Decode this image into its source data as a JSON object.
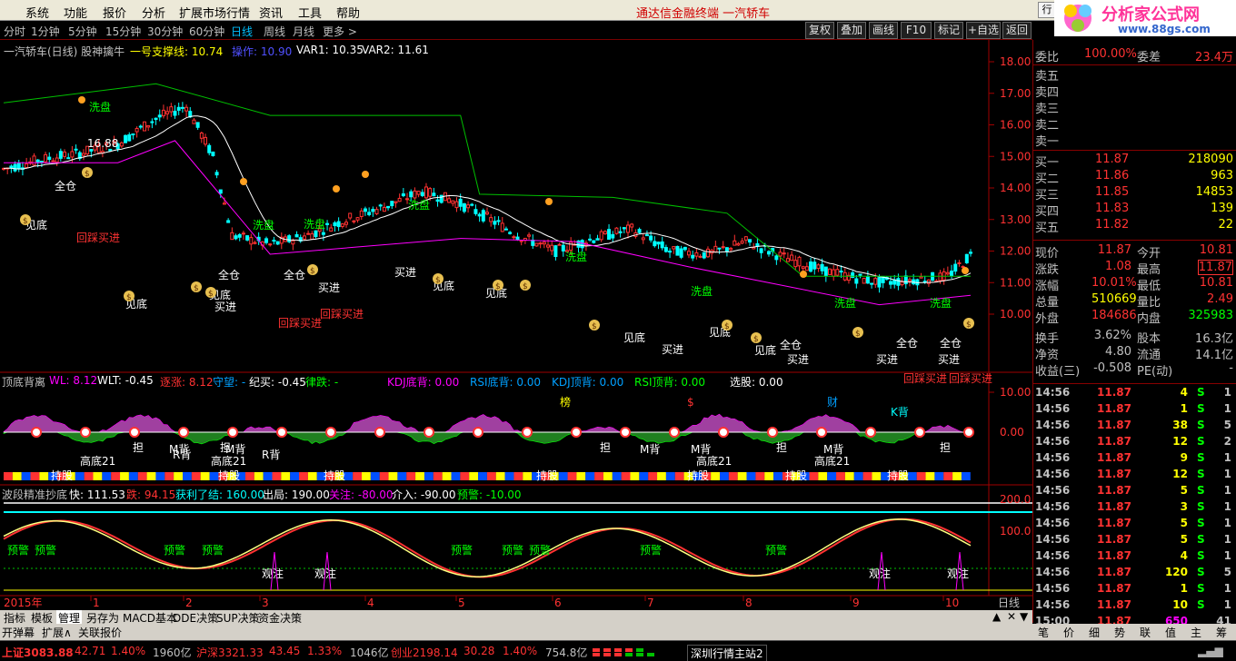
{
  "menu": [
    "系统",
    "功能",
    "报价",
    "分析",
    "扩展市场行情",
    "资讯",
    "工具",
    "帮助"
  ],
  "center_title": "通达信金融终端   一汽轿车",
  "periods": [
    "分时",
    "1分钟",
    "5分钟",
    "15分钟",
    "30分钟",
    "60分钟",
    "日线",
    "周线",
    "月线",
    "更多 >"
  ],
  "right_buttons": [
    "复权",
    "叠加",
    "画线",
    "F10",
    "标记",
    "+自选",
    "返回"
  ],
  "header": {
    "title": "一汽轿车(日线) 股神擒牛",
    "support": "一号支撑线: 10.74",
    "op": "操作: 10.90",
    "var1": "VAR1: 10.35",
    "var2": "VAR2: 11.61"
  },
  "price_axis": [
    "18.00",
    "17.00",
    "16.00",
    "15.00",
    "14.00",
    "13.00",
    "12.00",
    "11.00",
    "10.00"
  ],
  "ind1": {
    "title": "顶底背离",
    "wl": "WL: 8.12",
    "wlt": "WLT: -0.45",
    "zhang": "逐涨: 8.12",
    "sw": "守望: -",
    "jm": "纪买: -0.45",
    "lj": "律跌: -",
    "kdjdi": "KDJ底背: 0.00",
    "rsidi": "RSI底背: 0.00",
    "kdjding": "KDJ顶背: 0.00",
    "rsiding": "RSI顶背: 0.00",
    "xg": "选股: 0.00",
    "axis": [
      "10.00",
      "0.00"
    ]
  },
  "ind2": {
    "title": "波段精准抄底",
    "kuai": "快: 111.53",
    "die": "跌: 94.15",
    "hl": "获利了结: 160.00",
    "cj": "出局: 190.00",
    "gz": "关注: -80.00",
    "jr": "介入: -90.00",
    "yj": "预警: -10.00",
    "axis": [
      "200.0",
      "100.0"
    ]
  },
  "chart_labels": {
    "xipan": "洗盘",
    "quancang": "全仓",
    "jiandi": "见底",
    "mairu": "买进",
    "huicai": "回踩买进",
    "high": "16.88",
    "bang": "榜",
    "cai": "财",
    "gaodi": "高底21",
    "rbei": "R背",
    "mbei": "M背",
    "dan": "担",
    "chigu": "持股",
    "kbei": "K背",
    "guanzhu": "观注",
    "yujing": "预警",
    "dollar": "$"
  },
  "xaxis": {
    "year": "2015年",
    "months": [
      "1",
      "2",
      "3",
      "4",
      "5",
      "6",
      "7",
      "8",
      "9",
      "10"
    ],
    "period": "日线"
  },
  "quote": {
    "webi": "委比",
    "webi_v": "100.00%",
    "wecha": "委差",
    "wecha_v": "23.4万",
    "sells": [
      {
        "l": "卖五"
      },
      {
        "l": "卖四"
      },
      {
        "l": "卖三"
      },
      {
        "l": "卖二"
      },
      {
        "l": "卖一"
      }
    ],
    "buys": [
      {
        "l": "买一",
        "p": "11.87",
        "v": "218090"
      },
      {
        "l": "买二",
        "p": "11.86",
        "v": "963"
      },
      {
        "l": "买三",
        "p": "11.85",
        "v": "14853"
      },
      {
        "l": "买四",
        "p": "11.83",
        "v": "139"
      },
      {
        "l": "买五",
        "p": "11.82",
        "v": "22"
      }
    ],
    "rows": [
      [
        "现价",
        "11.87",
        "今开",
        "10.81"
      ],
      [
        "涨跌",
        "1.08",
        "最高",
        "11.87"
      ],
      [
        "涨幅",
        "10.01%",
        "最低",
        "10.81"
      ],
      [
        "总量",
        "510669",
        "量比",
        "2.49"
      ],
      [
        "外盘",
        "184686",
        "内盘",
        "325983"
      ],
      [
        "换手",
        "3.62%",
        "股本",
        "16.3亿"
      ],
      [
        "净资",
        "4.80",
        "流通",
        "14.1亿"
      ],
      [
        "收益(三)",
        "-0.508",
        "PE(动)",
        "-"
      ]
    ],
    "ticks": [
      [
        "14:56",
        "11.87",
        "4",
        "S",
        "1"
      ],
      [
        "14:56",
        "11.87",
        "1",
        "S",
        "1"
      ],
      [
        "14:56",
        "11.87",
        "38",
        "S",
        "5"
      ],
      [
        "14:56",
        "11.87",
        "12",
        "S",
        "2"
      ],
      [
        "14:56",
        "11.87",
        "9",
        "S",
        "1"
      ],
      [
        "14:56",
        "11.87",
        "12",
        "S",
        "1"
      ],
      [
        "14:56",
        "11.87",
        "5",
        "S",
        "1"
      ],
      [
        "14:56",
        "11.87",
        "3",
        "S",
        "1"
      ],
      [
        "14:56",
        "11.87",
        "5",
        "S",
        "1"
      ],
      [
        "14:56",
        "11.87",
        "5",
        "S",
        "1"
      ],
      [
        "14:56",
        "11.87",
        "4",
        "S",
        "1"
      ],
      [
        "14:56",
        "11.87",
        "120",
        "S",
        "5"
      ],
      [
        "14:56",
        "11.87",
        "1",
        "S",
        "1"
      ],
      [
        "14:56",
        "11.87",
        "10",
        "S",
        "1"
      ],
      [
        "15:00",
        "11.87",
        "650",
        "",
        "41"
      ]
    ]
  },
  "tabs1": [
    "指标",
    "模板",
    "管理",
    "另存为",
    "MACD基本",
    "DDE决策",
    "SUP决策",
    "资金决策"
  ],
  "tabs2": [
    "开弹幕",
    "扩展∧",
    "关联报价"
  ],
  "rtabs": [
    "笔",
    "价",
    "细",
    "势",
    "联",
    "值",
    "主",
    "筹"
  ],
  "status": {
    "sh": "上证3083.88",
    "sh_ch": "42.71",
    "sh_pct": "1.40%",
    "sh_amt": "1960亿",
    "sz": "沪深3321.33",
    "sz_ch": "43.45",
    "sz_pct": "1.33%",
    "sz_amt": "1046亿",
    "cy": "创业2198.14",
    "cy_ch": "30.28",
    "cy_pct": "1.40%",
    "cy_amt": "754.8亿",
    "site": "深圳行情主站2"
  },
  "logo": {
    "cn": "分析家公式网",
    "url": "www.88gs.com"
  },
  "colors": {
    "up": "#ff3232",
    "down": "#00ffff",
    "text": "#c0c0c0",
    "yellow": "#ffff00",
    "green": "#00ff00",
    "magenta": "#ff00ff"
  }
}
